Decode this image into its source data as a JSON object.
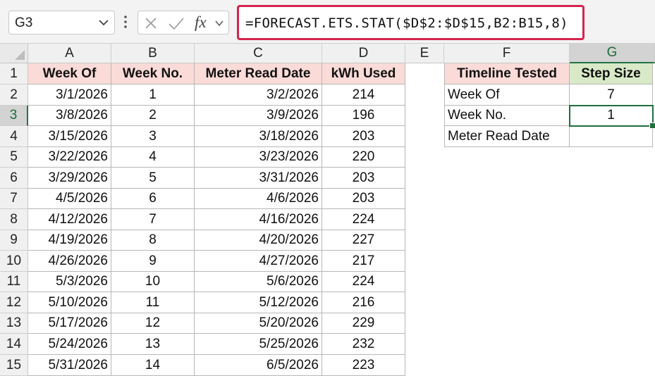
{
  "formula_bar": {
    "name_box": "G3",
    "fx_label": "fx",
    "formula": "=FORECAST.ETS.STAT($D$2:$D$15,B2:B15,8)"
  },
  "columns": [
    "A",
    "B",
    "C",
    "D",
    "E",
    "F",
    "G"
  ],
  "rows": [
    "1",
    "2",
    "3",
    "4",
    "5",
    "6",
    "7",
    "8",
    "9",
    "10",
    "11",
    "12",
    "13",
    "14",
    "15"
  ],
  "selected_column": "G",
  "selected_row": "3",
  "table": {
    "headers": [
      "Week Of",
      "Week No.",
      "Meter Read Date",
      "kWh Used"
    ],
    "rows": [
      [
        "3/1/2026",
        "1",
        "3/2/2026",
        "214"
      ],
      [
        "3/8/2026",
        "2",
        "3/9/2026",
        "196"
      ],
      [
        "3/15/2026",
        "3",
        "3/18/2026",
        "203"
      ],
      [
        "3/22/2026",
        "4",
        "3/23/2026",
        "220"
      ],
      [
        "3/29/2026",
        "5",
        "3/31/2026",
        "203"
      ],
      [
        "4/5/2026",
        "6",
        "4/6/2026",
        "203"
      ],
      [
        "4/12/2026",
        "7",
        "4/16/2026",
        "224"
      ],
      [
        "4/19/2026",
        "8",
        "4/20/2026",
        "227"
      ],
      [
        "4/26/2026",
        "9",
        "4/27/2026",
        "217"
      ],
      [
        "5/3/2026",
        "10",
        "5/6/2026",
        "224"
      ],
      [
        "5/10/2026",
        "11",
        "5/12/2026",
        "216"
      ],
      [
        "5/17/2026",
        "12",
        "5/20/2026",
        "229"
      ],
      [
        "5/24/2026",
        "13",
        "5/25/2026",
        "232"
      ],
      [
        "5/31/2026",
        "14",
        "6/5/2026",
        "223"
      ]
    ]
  },
  "side_table": {
    "headers": [
      "Timeline Tested",
      "Step Size"
    ],
    "rows": [
      [
        "Week Of",
        "7"
      ],
      [
        "Week No.",
        "1"
      ],
      [
        "Meter Read Date",
        ""
      ]
    ]
  },
  "colors": {
    "formula_highlight": "#d6244e",
    "header_pink": "#fadbd8",
    "header_green": "#d8e9c7",
    "selection_green": "#217346"
  },
  "icons": [
    "chevron-down-icon",
    "vertical-dots-icon",
    "cancel-icon",
    "enter-check-icon",
    "fx-icon"
  ]
}
